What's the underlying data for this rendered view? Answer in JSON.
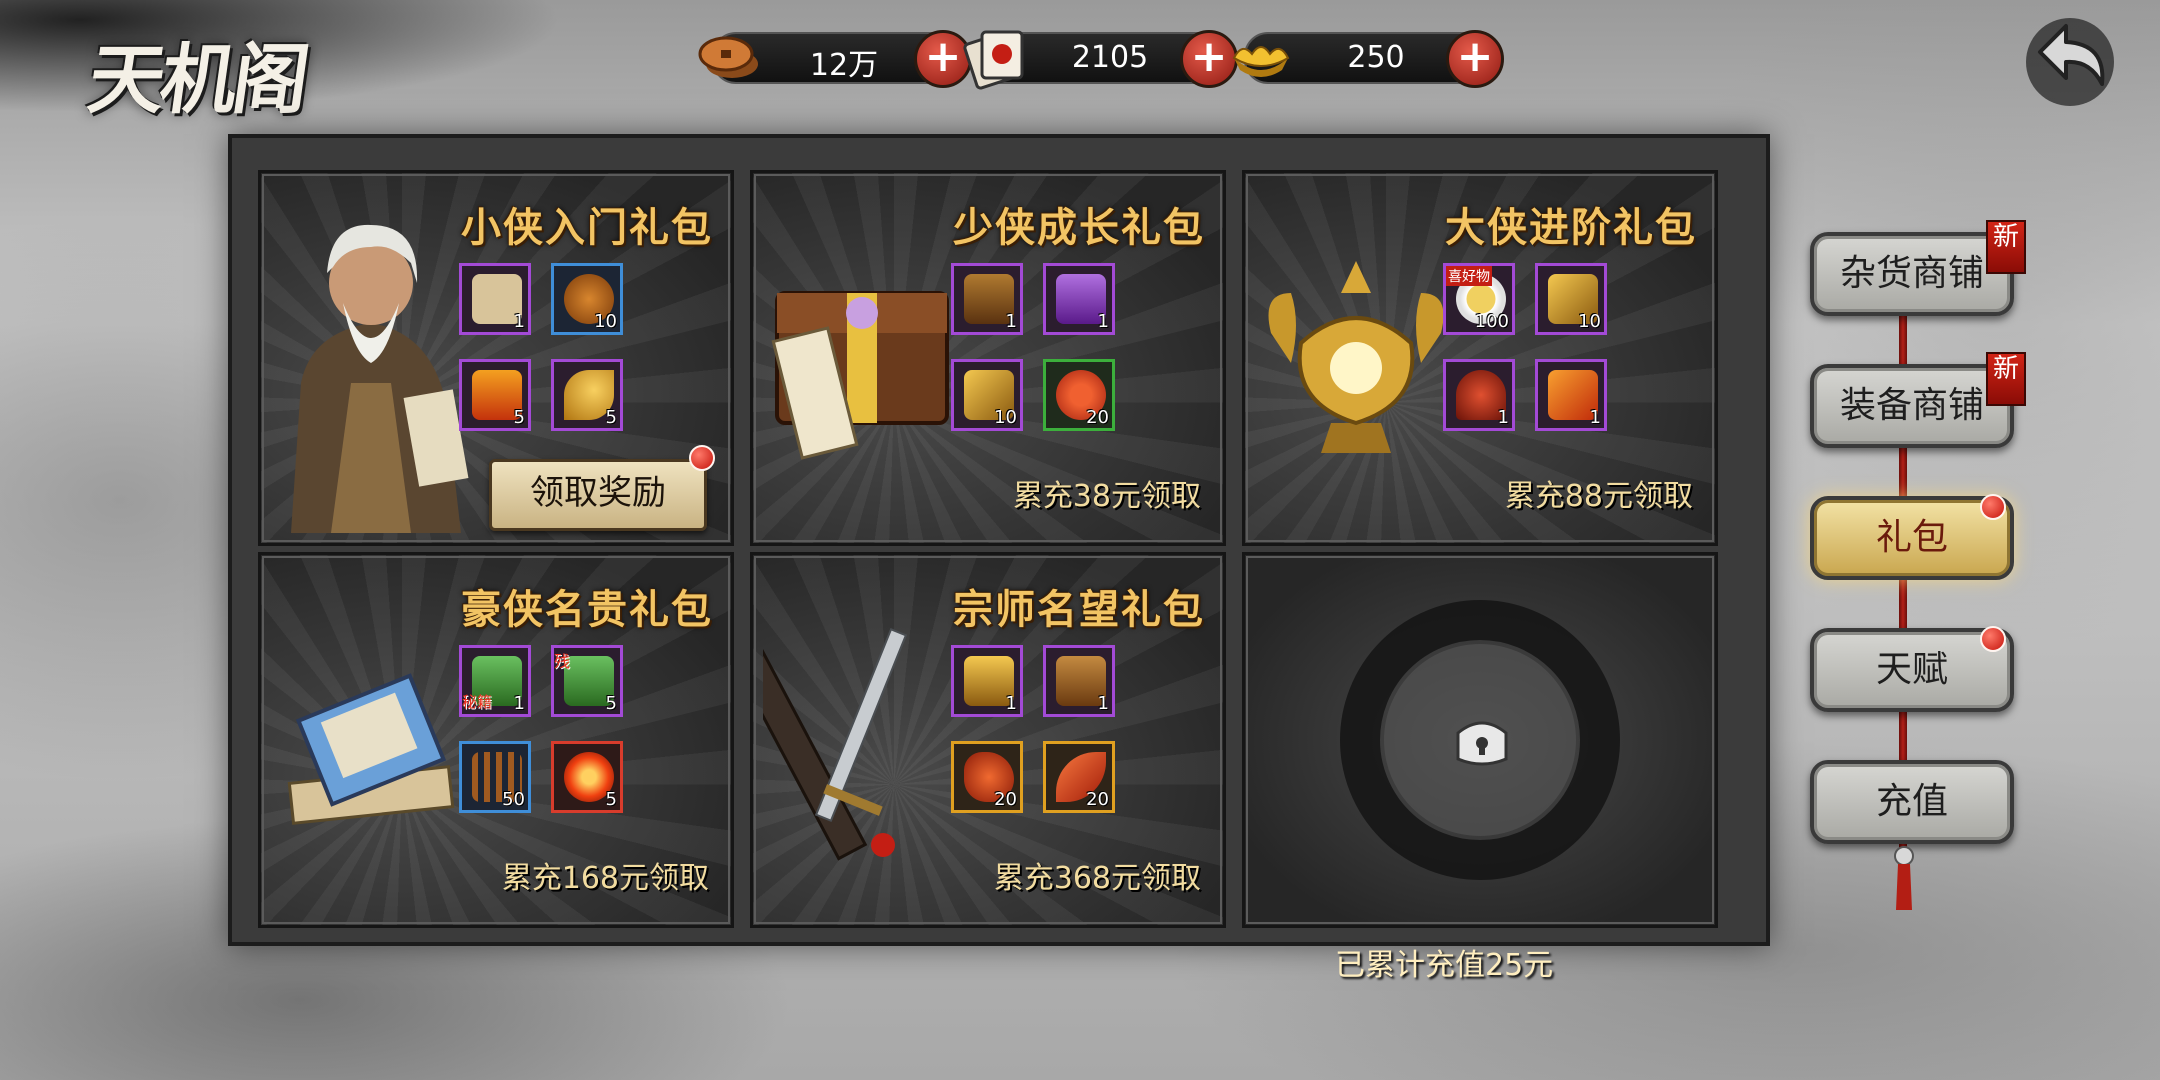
{
  "header": {
    "title": "天机阁",
    "resources": [
      {
        "name": "copper-coins",
        "value": "12万"
      },
      {
        "name": "tickets",
        "value": "2105"
      },
      {
        "name": "gold-ingot",
        "value": "250"
      }
    ]
  },
  "packs": [
    {
      "title": "小侠入门礼包",
      "action_label": "领取奖励",
      "items": [
        {
          "icon": "portrait-scroll",
          "count": "1"
        },
        {
          "icon": "roast-chicken",
          "count": "10"
        },
        {
          "icon": "treasure-box",
          "count": "5"
        },
        {
          "icon": "golden-leaf",
          "count": "5"
        }
      ]
    },
    {
      "title": "少侠成长礼包",
      "condition": "累充38元领取",
      "items": [
        {
          "icon": "wooden-chest",
          "count": "1"
        },
        {
          "icon": "purple-robe",
          "count": "1"
        },
        {
          "icon": "gold-fragment",
          "count": "10"
        },
        {
          "icon": "red-fruits",
          "count": "20"
        }
      ]
    },
    {
      "title": "大侠进阶礼包",
      "condition": "累充88元领取",
      "items": [
        {
          "icon": "dish",
          "count": "100",
          "tag": "喜好物"
        },
        {
          "icon": "gold-fragment",
          "count": "10"
        },
        {
          "icon": "lingzhi",
          "count": "1"
        },
        {
          "icon": "gold-ore",
          "count": "1"
        }
      ]
    },
    {
      "title": "豪侠名贵礼包",
      "condition": "累充168元领取",
      "items": [
        {
          "icon": "green-book",
          "count": "1",
          "tag": "秘籍"
        },
        {
          "icon": "green-book",
          "count": "5",
          "tag": "残"
        },
        {
          "icon": "incense",
          "count": "50"
        },
        {
          "icon": "fire-orb",
          "count": "5"
        }
      ]
    },
    {
      "title": "宗师名望礼包",
      "condition": "累充368元领取",
      "items": [
        {
          "icon": "golden-chest",
          "count": "1"
        },
        {
          "icon": "armor-book",
          "count": "1"
        },
        {
          "icon": "red-crystal",
          "count": "20"
        },
        {
          "icon": "red-feather",
          "count": "20"
        }
      ]
    }
  ],
  "total_recharge": "已累计充值25元",
  "sidebar": {
    "items": [
      {
        "label": "杂货商铺",
        "badge": "新"
      },
      {
        "label": "装备商铺",
        "badge": "新"
      },
      {
        "label": "礼包"
      },
      {
        "label": "天赋"
      },
      {
        "label": "充值"
      }
    ]
  },
  "colors": {
    "title_gold": "#f2c464",
    "slot_purple": "#a34ad6",
    "slot_blue": "#3f8ed8",
    "alert_red": "#c4120a"
  }
}
